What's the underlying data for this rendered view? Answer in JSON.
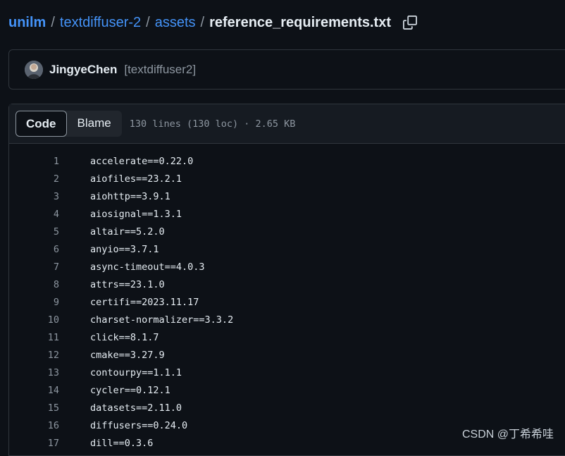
{
  "breadcrumb": {
    "repo": "unilm",
    "folder1": "textdiffuser-2",
    "folder2": "assets",
    "file": "reference_requirements.txt",
    "separator": "/"
  },
  "commit": {
    "author": "JingyeChen",
    "message": "[textdiffuser2]"
  },
  "file_header": {
    "code_tab": "Code",
    "blame_tab": "Blame",
    "meta": "130 lines (130 loc) · 2.65 KB"
  },
  "lines": [
    {
      "n": "1",
      "text": "accelerate==0.22.0"
    },
    {
      "n": "2",
      "text": "aiofiles==23.2.1"
    },
    {
      "n": "3",
      "text": "aiohttp==3.9.1"
    },
    {
      "n": "4",
      "text": "aiosignal==1.3.1"
    },
    {
      "n": "5",
      "text": "altair==5.2.0"
    },
    {
      "n": "6",
      "text": "anyio==3.7.1"
    },
    {
      "n": "7",
      "text": "async-timeout==4.0.3"
    },
    {
      "n": "8",
      "text": "attrs==23.1.0"
    },
    {
      "n": "9",
      "text": "certifi==2023.11.17"
    },
    {
      "n": "10",
      "text": "charset-normalizer==3.3.2"
    },
    {
      "n": "11",
      "text": "click==8.1.7"
    },
    {
      "n": "12",
      "text": "cmake==3.27.9"
    },
    {
      "n": "13",
      "text": "contourpy==1.1.1"
    },
    {
      "n": "14",
      "text": "cycler==0.12.1"
    },
    {
      "n": "15",
      "text": "datasets==2.11.0"
    },
    {
      "n": "16",
      "text": "diffusers==0.24.0"
    },
    {
      "n": "17",
      "text": "dill==0.3.6"
    }
  ],
  "watermark": "CSDN @丁希希哇",
  "icons": {
    "copy": "copy-icon",
    "avatar": "avatar"
  }
}
